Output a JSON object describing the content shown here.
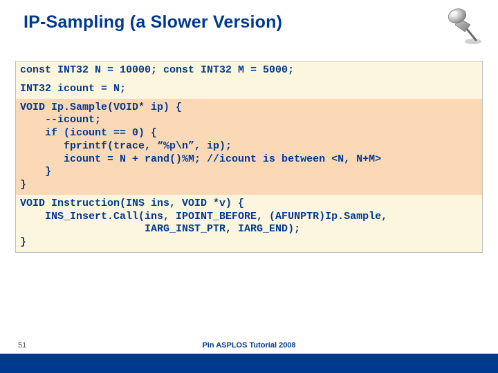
{
  "title": "IP-Sampling (a Slower Version)",
  "code": {
    "decl1": "const INT32 N = 10000; const INT32 M = 5000;",
    "decl2": "INT32 icount = N;",
    "ipsample": "VOID Ip.Sample(VOID* ip) {\n    --icount;\n    if (icount == 0) {\n       fprintf(trace, “%p\\n”, ip);\n       icount = N + rand()%M; //icount is between <N, N+M>\n    }\n}",
    "instruction": "VOID Instruction(INS ins, VOID *v) {\n    INS_Insert.Call(ins, IPOINT_BEFORE, (AFUNPTR)Ip.Sample,\n                    IARG_INST_PTR, IARG_END);\n}"
  },
  "footer": {
    "page": "51",
    "text": "Pin ASPLOS Tutorial 2008"
  },
  "icons": {
    "pin": "pushpin-icon"
  }
}
